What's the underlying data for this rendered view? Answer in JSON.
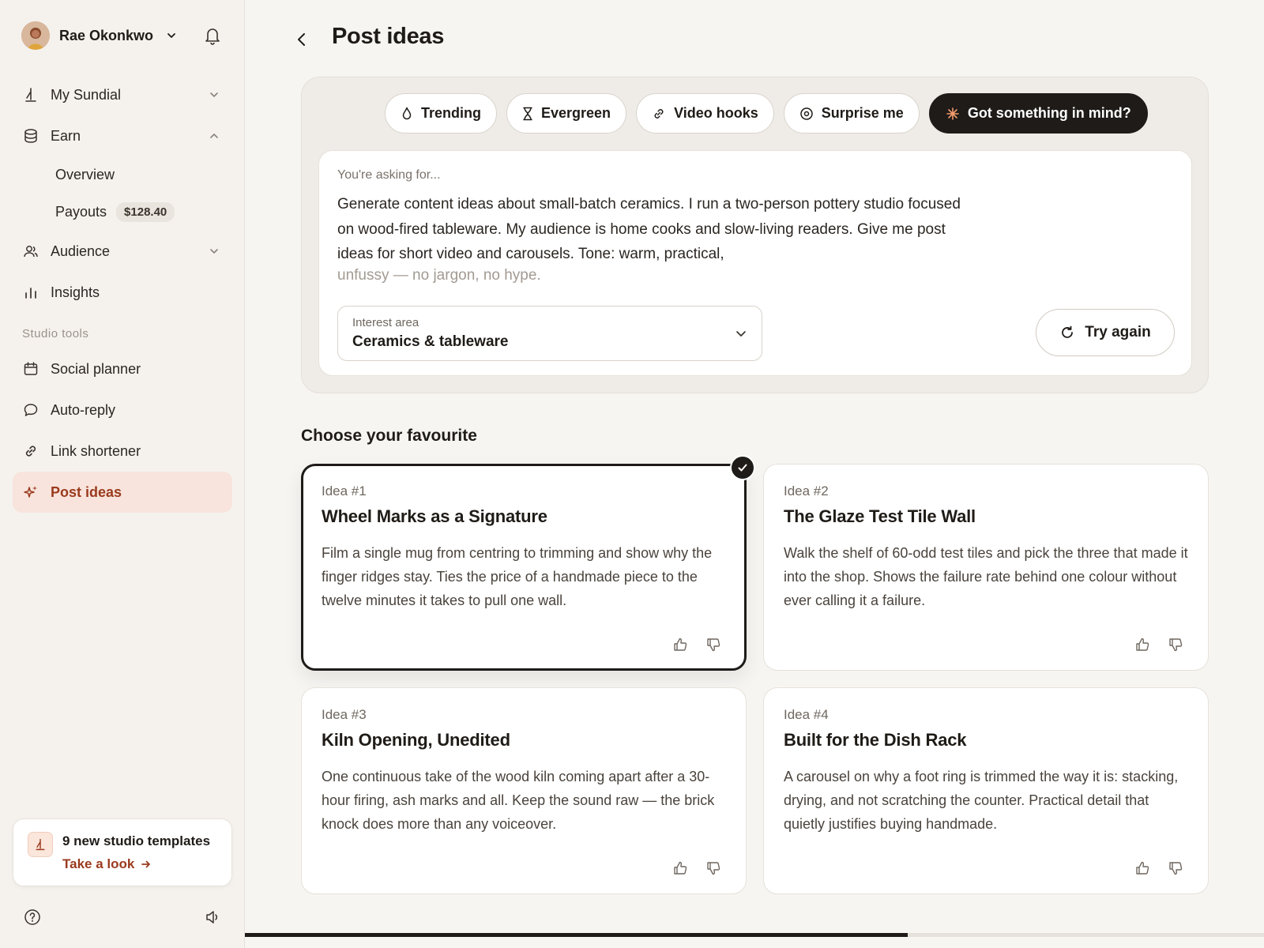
{
  "user": {
    "name": "Rae Okonkwo"
  },
  "nav": {
    "my_sundial": "My Sundial",
    "earn": "Earn",
    "earn_sub": [
      {
        "label": "Overview"
      },
      {
        "label": "Payouts",
        "badge": "$128.40"
      }
    ],
    "audience": "Audience",
    "insights": "Insights",
    "section_label": "Studio tools",
    "tools": [
      "Social planner",
      "Auto-reply",
      "Link shortener",
      "Post ideas"
    ]
  },
  "promo": {
    "title": "9 new studio templates",
    "link": "Take a look"
  },
  "page": {
    "title": "Post ideas"
  },
  "chips": [
    "Trending",
    "Evergreen",
    "Video hooks",
    "Surprise me",
    "Got something in mind?"
  ],
  "prompt": {
    "asking_label": "You're asking for...",
    "text": "Generate content ideas about small-batch ceramics. I run a two-person pottery studio focused on wood-fired tableware. My audience is home cooks and slow-living readers. Give me post ideas for short video and carousels. Tone: warm, practical,",
    "faded_text": "unfussy — no jargon, no hype.",
    "interest_label": "Interest area",
    "interest_value": "Ceramics & tableware",
    "try_again": "Try again"
  },
  "ideas_section": {
    "title": "Choose your favourite"
  },
  "ideas": [
    {
      "num": "Idea #1",
      "title": "Wheel Marks as a Signature",
      "desc": "Film a single mug from centring to trimming and show why the finger ridges stay. Ties the price of a handmade piece to the twelve minutes it takes to pull one wall.",
      "selected": true
    },
    {
      "num": "Idea #2",
      "title": "The Glaze Test Tile Wall",
      "desc": "Walk the shelf of 60-odd test tiles and pick the three that made it into the shop. Shows the failure rate behind one colour without ever calling it a failure.",
      "selected": false
    },
    {
      "num": "Idea #3",
      "title": "Kiln Opening, Unedited",
      "desc": "One continuous take of the wood kiln coming apart after a 30-hour firing, ash marks and all. Keep the sound raw — the brick knock does more than any voiceover.",
      "selected": false
    },
    {
      "num": "Idea #4",
      "title": "Built for the Dish Rack",
      "desc": "A carousel on why a foot ring is trimmed the way it is: stacking, drying, and not scratching the counter. Practical detail that quietly justifies buying handmade.",
      "selected": false
    }
  ],
  "progress": {
    "value": 0.65
  },
  "colors": {
    "accent": "#9a3a1e",
    "active_bg": "#f8e4dc",
    "dark": "#1e1b18"
  }
}
